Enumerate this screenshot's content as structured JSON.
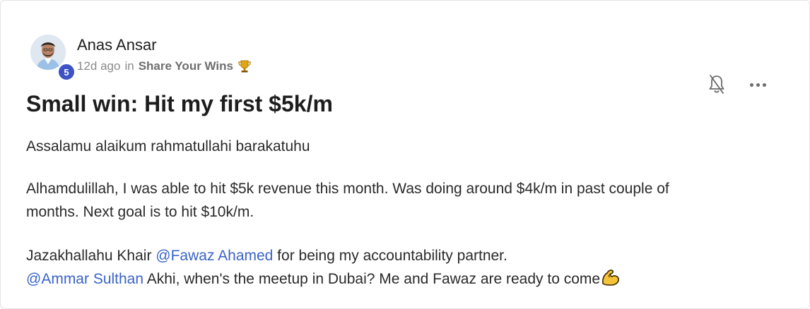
{
  "post": {
    "author": {
      "name": "Anas Ansar",
      "level": "5",
      "avatar_icon": "person-photo"
    },
    "meta": {
      "time": "12d ago",
      "in_word": "in",
      "category": "Share Your Wins",
      "category_icon": "trophy-icon"
    },
    "actions": {
      "notify_icon": "bell-off-icon",
      "more_icon": "more-horizontal-icon"
    },
    "title": "Small win: Hit my first $5k/m",
    "body": {
      "p1": "Assalamu alaikum rahmatullahi barakatuhu",
      "p2_line1": "Alhamdulillah, I was able to hit $5k revenue this month. Was doing around $4k/m in past couple of",
      "p2_line2": "months. Next goal is to hit $10k/m.",
      "p3_line1_before": "Jazakhallahu Khair ",
      "p3_mention1": "@Fawaz Ahamed",
      "p3_line1_after": " for being my accountability partner.",
      "p3_mention2": "@Ammar Sulthan",
      "p3_line2_after": " Akhi, when's the meetup in Dubai? Me and Fawaz are ready to come",
      "p3_emoji": "flexed-biceps-icon"
    }
  },
  "colors": {
    "mention": "#3a64c8",
    "badge": "#3d53c4",
    "muted_text": "#8a8a8a"
  }
}
